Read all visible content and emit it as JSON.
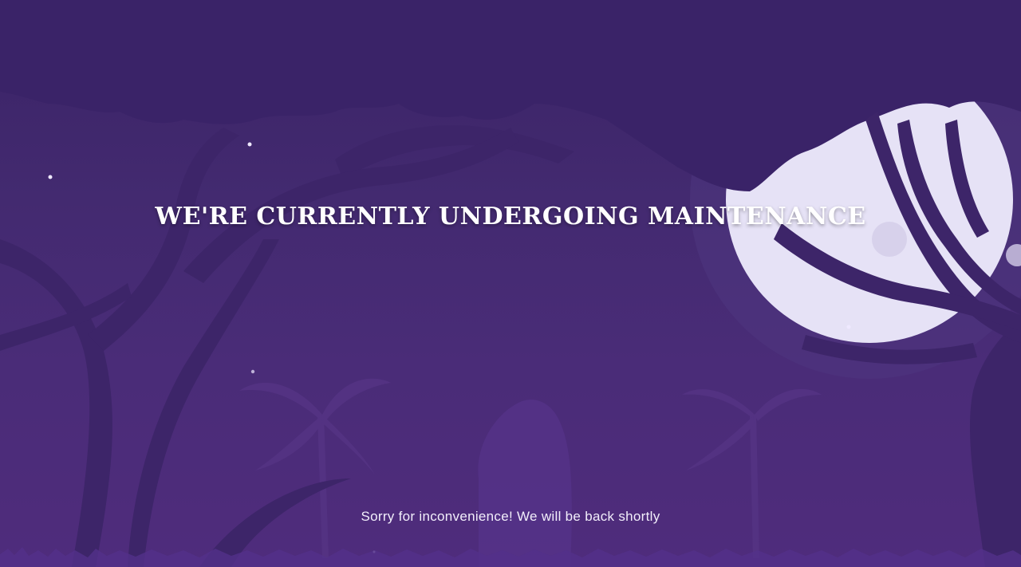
{
  "page": {
    "heading": "We're currently undergoing maintenance",
    "subheading": "Sorry for inconvenience! We will be back shortly"
  },
  "colors": {
    "background_top": "#3a2366",
    "background_bottom": "#4f2c7c",
    "moon": "#e6e2f6",
    "tree_silhouette": "#3b2468",
    "text": "#ffffff"
  },
  "icons": {
    "moon": "moon-illustration",
    "trees": "tree-silhouette-illustration",
    "palms": "palm-tree-illustration",
    "fireflies": "firefly-dot"
  }
}
